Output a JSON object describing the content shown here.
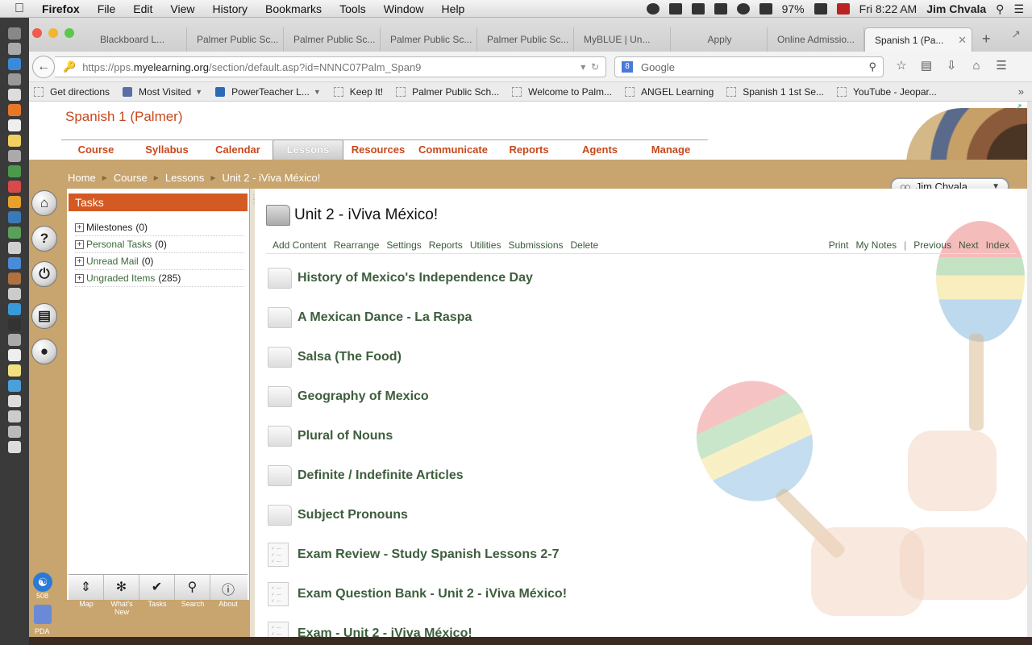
{
  "menubar": {
    "app": "Firefox",
    "items": [
      "File",
      "Edit",
      "View",
      "History",
      "Bookmarks",
      "Tools",
      "Window",
      "Help"
    ],
    "battery": "97%",
    "clock": "Fri 8:22 AM",
    "user": "Jim Chvala"
  },
  "tabs": [
    {
      "label": "Blackboard L..."
    },
    {
      "label": "Palmer Public Sc..."
    },
    {
      "label": "Palmer Public Sc..."
    },
    {
      "label": "Palmer Public Sc..."
    },
    {
      "label": "Palmer Public Sc..."
    },
    {
      "label": "MyBLUE | Un..."
    },
    {
      "label": "Apply"
    },
    {
      "label": "Online Admissio..."
    },
    {
      "label": "Spanish 1 (Pa..."
    }
  ],
  "navbar": {
    "url_prefix": "https://pps.",
    "url_domain": "myelearning.org",
    "url_path": "/section/default.asp?id=NNNC07Palm_Span9",
    "search_placeholder": "Google"
  },
  "bookmarks": [
    {
      "label": "Get directions",
      "folder": false
    },
    {
      "label": "Most Visited",
      "folder": true
    },
    {
      "label": "PowerTeacher L...",
      "folder": true
    },
    {
      "label": "Keep It!",
      "folder": false
    },
    {
      "label": "Palmer Public Sch...",
      "folder": false
    },
    {
      "label": "Welcome to Palm...",
      "folder": false
    },
    {
      "label": "ANGEL Learning",
      "folder": false
    },
    {
      "label": "Spanish 1 1st Se...",
      "folder": false
    },
    {
      "label": "YouTube - Jeopar...",
      "folder": false
    }
  ],
  "course": {
    "title": "Spanish 1 (Palmer)",
    "nav": [
      "Course",
      "Syllabus",
      "Calendar",
      "Lessons",
      "Resources",
      "Communicate",
      "Reports",
      "Agents",
      "Manage"
    ],
    "active_nav": "Lessons"
  },
  "breadcrumb": [
    "Home",
    "Course",
    "Lessons",
    "Unit 2 - iViva México!"
  ],
  "user_menu": {
    "name": "Jim Chvala"
  },
  "tasks": {
    "header": "Tasks",
    "items": [
      {
        "label": "Milestones",
        "count": "(0)"
      },
      {
        "label": "Personal Tasks",
        "count": "(0)"
      },
      {
        "label": "Unread Mail",
        "count": "(0)"
      },
      {
        "label": "Ungraded Items",
        "count": "(285)"
      }
    ]
  },
  "tools": [
    {
      "label": "Map",
      "icon": "map-icon"
    },
    {
      "label": "What's New",
      "icon": "whats-new-icon"
    },
    {
      "label": "Tasks",
      "icon": "checkmark-icon"
    },
    {
      "label": "Search",
      "icon": "search-icon"
    },
    {
      "label": "About",
      "icon": "info-icon"
    }
  ],
  "rail": {
    "accessibility_number": "508",
    "pda_label": "PDA"
  },
  "unit": {
    "title": "Unit 2 - iViva México!",
    "actions": [
      "Add Content",
      "Rearrange",
      "Settings",
      "Reports",
      "Utilities",
      "Submissions",
      "Delete"
    ],
    "right_actions": [
      "Print",
      "My Notes",
      "Previous",
      "Next",
      "Index"
    ],
    "items": [
      {
        "label": "History of Mexico's Independence Day",
        "type": "folder"
      },
      {
        "label": "A Mexican Dance - La Raspa",
        "type": "folder"
      },
      {
        "label": "Salsa (The Food)",
        "type": "folder"
      },
      {
        "label": "Geography of Mexico",
        "type": "folder"
      },
      {
        "label": "Plural of Nouns",
        "type": "folder"
      },
      {
        "label": "Definite / Indefinite Articles",
        "type": "folder"
      },
      {
        "label": "Subject Pronouns",
        "type": "folder"
      },
      {
        "label": "Exam Review - Study Spanish Lessons 2-7",
        "type": "assessment"
      },
      {
        "label": "Exam Question Bank - Unit 2 - iViva México!",
        "type": "assessment"
      },
      {
        "label": "Exam - Unit 2 - iViva México!",
        "type": "assessment"
      }
    ]
  },
  "colors": {
    "accent": "#c8481c",
    "band": "#c8a46e",
    "link": "#3d5e3d",
    "task_header": "#d35a22"
  }
}
